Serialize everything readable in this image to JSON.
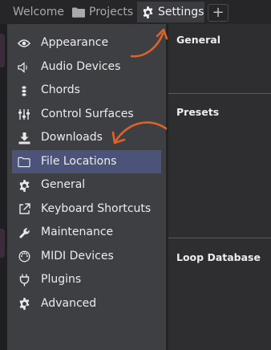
{
  "tabs": [
    {
      "label": "Welcome",
      "icon": "",
      "active": false
    },
    {
      "label": "Projects",
      "icon": "folder-icon",
      "active": false
    },
    {
      "label": "Settings",
      "icon": "gear-icon",
      "active": true
    }
  ],
  "add_tab_label": "+",
  "sidebar": {
    "items": [
      {
        "label": "Appearance",
        "icon": "eye-icon"
      },
      {
        "label": "Audio Devices",
        "icon": "speaker-icon"
      },
      {
        "label": "Chords",
        "icon": "chords-icon"
      },
      {
        "label": "Control Surfaces",
        "icon": "sliders-icon"
      },
      {
        "label": "Downloads",
        "icon": "download-icon"
      },
      {
        "label": "File Locations",
        "icon": "folder-icon",
        "selected": true
      },
      {
        "label": "General",
        "icon": "gear-icon"
      },
      {
        "label": "Keyboard Shortcuts",
        "icon": "external-link-icon"
      },
      {
        "label": "Maintenance",
        "icon": "wrench-icon"
      },
      {
        "label": "MIDI Devices",
        "icon": "midi-icon"
      },
      {
        "label": "Plugins",
        "icon": "plug-icon"
      },
      {
        "label": "Advanced",
        "icon": "gear-icon"
      }
    ]
  },
  "panel": {
    "sections": [
      {
        "title": "General"
      },
      {
        "title": "Presets"
      },
      {
        "title": "Loop Database"
      }
    ]
  },
  "colors": {
    "selected_bg": "#4b5378",
    "annotation_arrow": "#e0622a",
    "sidebar_bg": "#3e3f43",
    "panel_bg": "#2e2e31"
  }
}
